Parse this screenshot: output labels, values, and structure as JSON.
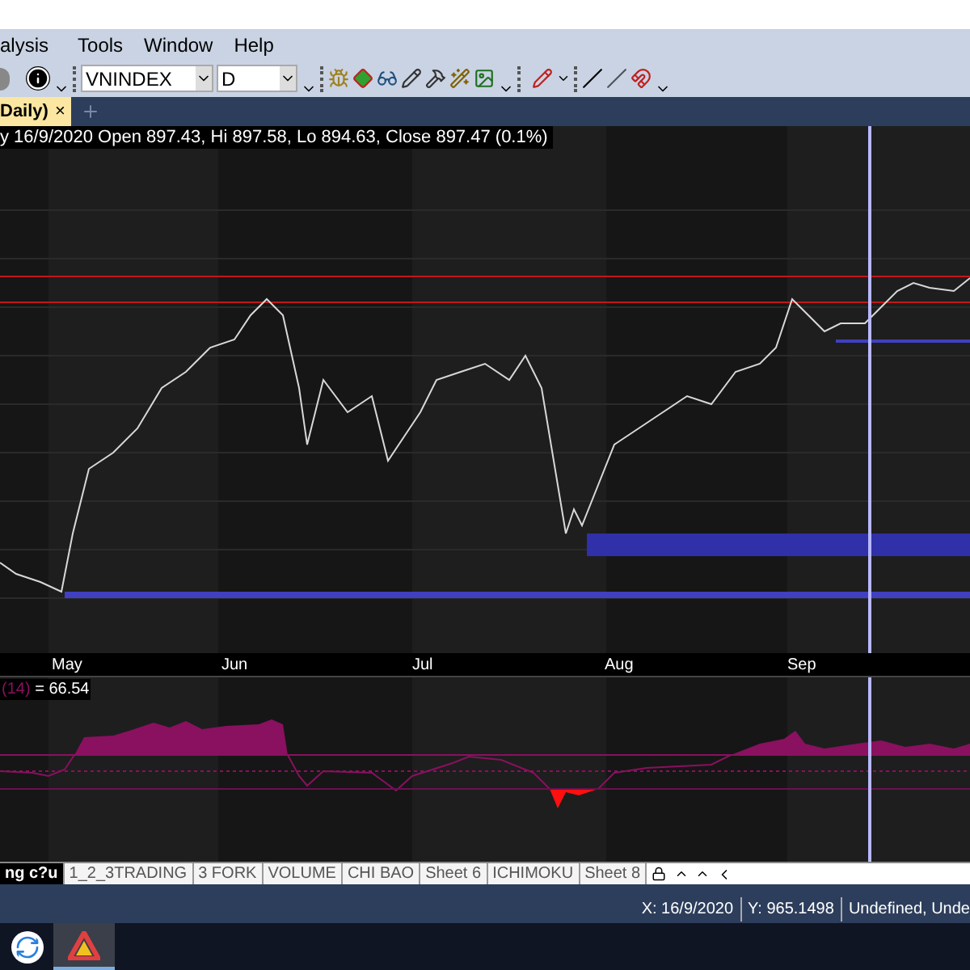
{
  "menu": [
    "alysis",
    "Tools",
    "Window",
    "Help"
  ],
  "toolbar": {
    "symbol": "VNINDEX",
    "period": "D"
  },
  "chart_tabs": [
    {
      "label": "Daily)",
      "close": "×",
      "selected": true
    }
  ],
  "chart": {
    "info": "y 16/9/2020 Open 897.43, Hi 897.58, Lo 894.63, Close 897.47 (0.1%)",
    "x_labels": [
      "May",
      "Jun",
      "Jul",
      "Aug",
      "Sep"
    ]
  },
  "indicator": {
    "param": "(14)",
    "value": "= 66.54"
  },
  "sheet_tabs": [
    {
      "label": "ng c?u",
      "selected": true
    },
    {
      "label": "1_2_3TRADING",
      "selected": false
    },
    {
      "label": "3 FORK",
      "selected": false
    },
    {
      "label": "VOLUME",
      "selected": false
    },
    {
      "label": "CHI BAO",
      "selected": false
    },
    {
      "label": "Sheet 6",
      "selected": false
    },
    {
      "label": "ICHIMOKU",
      "selected": false
    },
    {
      "label": "Sheet 8",
      "selected": false
    }
  ],
  "status_bar": [
    "X: 16/9/2020",
    "Y: 965.1498",
    "Undefined, Unde"
  ]
}
